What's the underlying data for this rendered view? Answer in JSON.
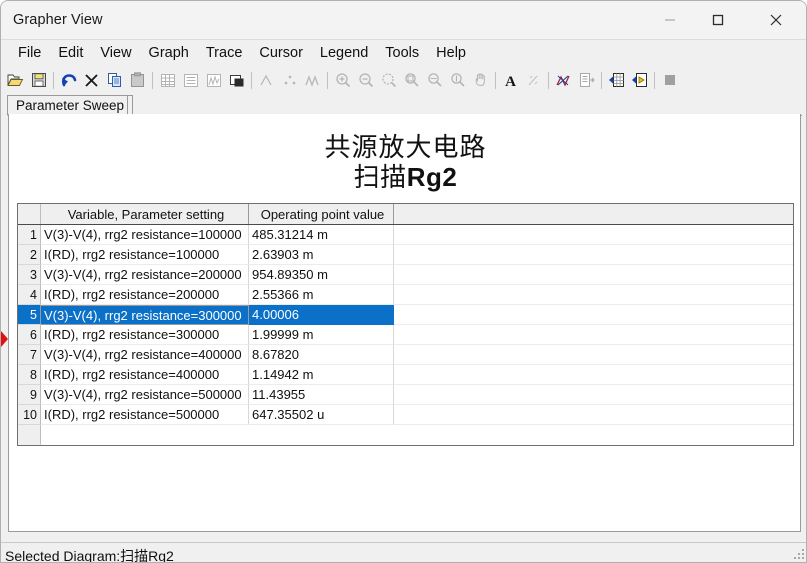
{
  "window": {
    "title": "Grapher View",
    "controls": {
      "minimize": "minimize-button",
      "maximize": "maximize-button",
      "close": "close-button"
    }
  },
  "menubar": {
    "items": [
      {
        "label": "File"
      },
      {
        "label": "Edit"
      },
      {
        "label": "View"
      },
      {
        "label": "Graph"
      },
      {
        "label": "Trace"
      },
      {
        "label": "Cursor"
      },
      {
        "label": "Legend"
      },
      {
        "label": "Tools"
      },
      {
        "label": "Help"
      }
    ]
  },
  "toolbar": {
    "groups": [
      {
        "buttons": [
          {
            "icon": "open-folder-icon",
            "enabled": true
          },
          {
            "icon": "save-disk-icon",
            "enabled": true
          }
        ]
      },
      {
        "buttons": [
          {
            "icon": "undo-arrow-icon",
            "enabled": true
          },
          {
            "icon": "delete-x-icon",
            "enabled": true
          },
          {
            "icon": "copy-icon",
            "enabled": true
          },
          {
            "icon": "paste-icon",
            "enabled": false
          }
        ]
      },
      {
        "buttons": [
          {
            "icon": "grid-icon",
            "enabled": false
          },
          {
            "icon": "legend-icon",
            "enabled": false
          },
          {
            "icon": "axes-icon",
            "enabled": false
          },
          {
            "icon": "restore-graph-icon",
            "enabled": true
          }
        ]
      },
      {
        "buttons": [
          {
            "icon": "curve-icon",
            "enabled": false
          },
          {
            "icon": "scatter-points-icon",
            "enabled": false
          },
          {
            "icon": "peaks-icon",
            "enabled": false
          }
        ]
      },
      {
        "buttons": [
          {
            "icon": "zoom-in-icon",
            "enabled": false
          },
          {
            "icon": "zoom-out-icon",
            "enabled": false
          },
          {
            "icon": "zoom-region-icon",
            "enabled": false
          },
          {
            "icon": "zoom-fit-icon",
            "enabled": false
          },
          {
            "icon": "zoom-horizontal-icon",
            "enabled": false
          },
          {
            "icon": "zoom-vertical-icon",
            "enabled": false
          },
          {
            "icon": "pan-hand-icon",
            "enabled": false
          }
        ]
      },
      {
        "buttons": [
          {
            "icon": "text-a-icon",
            "enabled": true
          },
          {
            "icon": "measure-icon",
            "enabled": false
          }
        ]
      },
      {
        "buttons": [
          {
            "icon": "cursor-trace-icon",
            "enabled": true
          },
          {
            "icon": "export-list-icon",
            "enabled": false
          }
        ]
      },
      {
        "buttons": [
          {
            "icon": "export-excel-icon",
            "enabled": true
          },
          {
            "icon": "export-labview-icon",
            "enabled": true
          }
        ]
      },
      {
        "buttons": [
          {
            "icon": "stop-square-icon",
            "enabled": false
          }
        ]
      }
    ]
  },
  "tabs": [
    {
      "label": "Parameter Sweep",
      "active": true
    }
  ],
  "sheet": {
    "heading_line1": "共源放大电路",
    "heading_line2_prefix": "扫描",
    "heading_line2_bold": "Rg2"
  },
  "grid": {
    "headers": {
      "row_number": "",
      "variable": "Variable, Parameter setting",
      "value": "Operating point value",
      "extra": ""
    },
    "selected_row_index": 5,
    "rows": [
      {
        "n": "1",
        "variable": "V(3)-V(4), rrg2 resistance=100000",
        "value": "485.31214 m"
      },
      {
        "n": "2",
        "variable": "I(RD), rrg2 resistance=100000",
        "value": "2.63903 m"
      },
      {
        "n": "3",
        "variable": "V(3)-V(4), rrg2 resistance=200000",
        "value": "954.89350 m"
      },
      {
        "n": "4",
        "variable": "I(RD), rrg2 resistance=200000",
        "value": "2.55366 m"
      },
      {
        "n": "5",
        "variable": "V(3)-V(4), rrg2 resistance=300000",
        "value": "4.00006"
      },
      {
        "n": "6",
        "variable": "I(RD), rrg2 resistance=300000",
        "value": "1.99999 m"
      },
      {
        "n": "7",
        "variable": "V(3)-V(4), rrg2 resistance=400000",
        "value": "8.67820"
      },
      {
        "n": "8",
        "variable": "I(RD), rrg2 resistance=400000",
        "value": "1.14942 m"
      },
      {
        "n": "9",
        "variable": "V(3)-V(4), rrg2 resistance=500000",
        "value": "11.43955"
      },
      {
        "n": "10",
        "variable": "I(RD), rrg2 resistance=500000",
        "value": "647.35502 u"
      }
    ]
  },
  "statusbar": {
    "text": "Selected Diagram:扫描Rg2"
  },
  "colors": {
    "selection_blue": "#0a70c8",
    "window_chrome": "#f0f0f0",
    "marker_red": "#e01010",
    "grid_border": "#6f6f6f"
  }
}
